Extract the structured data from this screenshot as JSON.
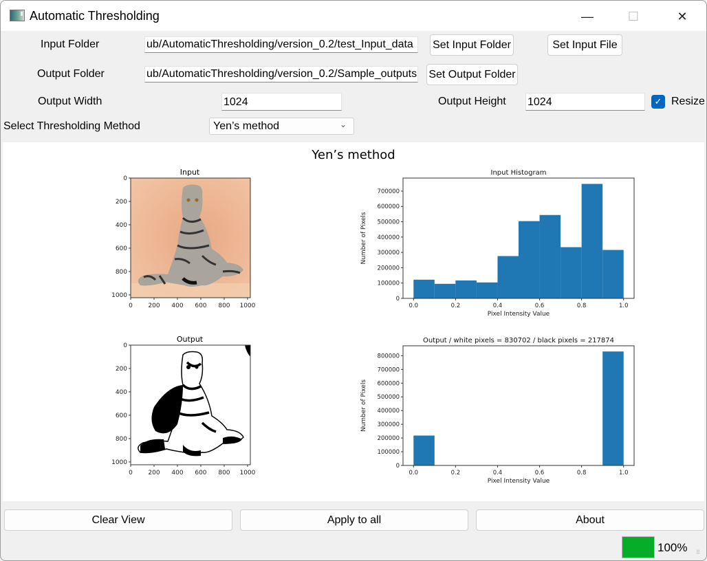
{
  "window": {
    "title": "Automatic Thresholding",
    "icon": "app-window-icon",
    "controls": {
      "minimize": "—",
      "maximize": "☐",
      "close": "✕"
    }
  },
  "form": {
    "input_folder_label": "Input Folder",
    "input_folder_value": "ub/AutomaticThresholding/version_0.2/test_Input_data",
    "set_input_folder": "Set Input Folder",
    "set_input_file": "Set Input File",
    "output_folder_label": "Output Folder",
    "output_folder_value": "ub/AutomaticThresholding/version_0.2/Sample_outputs",
    "set_output_folder": "Set Output Folder",
    "output_width_label": "Output Width",
    "output_width_value": "1024",
    "output_height_label": "Output Height",
    "output_height_value": "1024",
    "resize_label": "Resize",
    "resize_checked": true,
    "method_label": "Select Thresholding Method",
    "method_selected": "Yen’s method"
  },
  "figure": {
    "suptitle": "Yen’s method",
    "input_image": {
      "title": "Input",
      "xticks": [
        "0",
        "200",
        "400",
        "600",
        "800",
        "1000"
      ],
      "yticks": [
        "0",
        "200",
        "400",
        "600",
        "800",
        "1000"
      ]
    },
    "output_image": {
      "title": "Output",
      "xticks": [
        "0",
        "200",
        "400",
        "600",
        "800",
        "1000"
      ],
      "yticks": [
        "0",
        "200",
        "400",
        "600",
        "800",
        "1000"
      ]
    }
  },
  "chart_data": [
    {
      "type": "bar",
      "title": "Input Histogram",
      "xlabel": "Pixel Intensity Value",
      "ylabel": "Number of Pixels",
      "bin_edges": [
        0.0,
        0.1,
        0.2,
        0.3,
        0.4,
        0.5,
        0.6,
        0.7,
        0.8,
        0.9,
        1.0
      ],
      "values": [
        122000,
        95000,
        117000,
        104000,
        276000,
        504000,
        544000,
        334000,
        747000,
        316000
      ],
      "xlim": [
        -0.05,
        1.05
      ],
      "ylim": [
        0,
        785000
      ],
      "xticks": [
        "0.0",
        "0.2",
        "0.4",
        "0.6",
        "0.8",
        "1.0"
      ],
      "yticks": [
        "0",
        "100000",
        "200000",
        "300000",
        "400000",
        "500000",
        "600000",
        "700000"
      ],
      "color": "#1f77b4",
      "grid": false
    },
    {
      "type": "bar",
      "title": "Output / white pixels = 830702 / black pixels = 217874",
      "xlabel": "Pixel Intensity Value",
      "ylabel": "Number of Pixels",
      "bin_edges": [
        0.0,
        0.1,
        0.2,
        0.3,
        0.4,
        0.5,
        0.6,
        0.7,
        0.8,
        0.9,
        1.0
      ],
      "values": [
        217874,
        0,
        0,
        0,
        0,
        0,
        0,
        0,
        0,
        830702
      ],
      "xlim": [
        -0.05,
        1.05
      ],
      "ylim": [
        0,
        872000
      ],
      "xticks": [
        "0.0",
        "0.2",
        "0.4",
        "0.6",
        "0.8",
        "1.0"
      ],
      "yticks": [
        "0",
        "100000",
        "200000",
        "300000",
        "400000",
        "500000",
        "600000",
        "700000",
        "800000"
      ],
      "color": "#1f77b4",
      "grid": false
    }
  ],
  "footer": {
    "clear_view": "Clear View",
    "apply_to_all": "Apply to all",
    "about": "About",
    "progress_percent": 100,
    "progress_label": "100%",
    "progress_color": "#06ad29"
  }
}
